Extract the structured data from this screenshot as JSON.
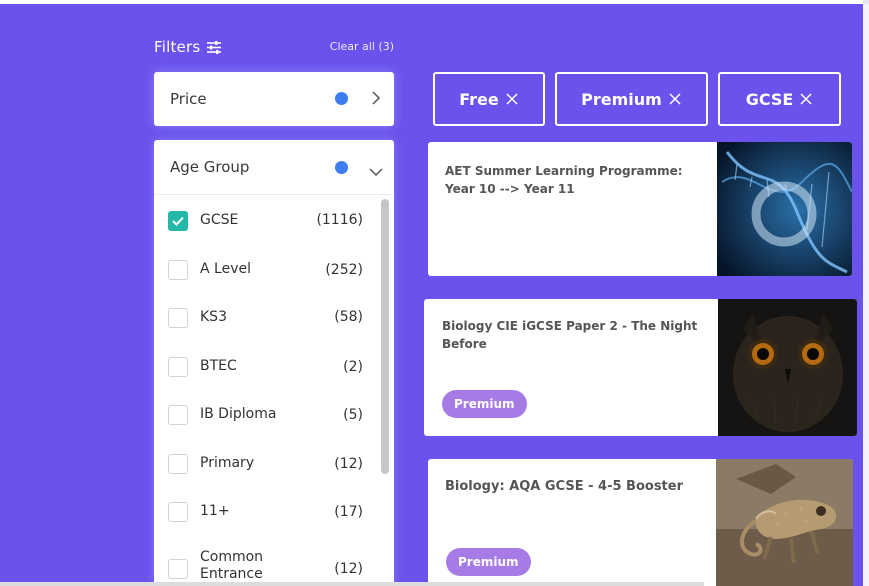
{
  "filters": {
    "title": "Filters",
    "clear_all": "Clear all (3)"
  },
  "price_panel": {
    "label": "Price"
  },
  "age_panel": {
    "label": "Age Group",
    "options": [
      {
        "label": "GCSE",
        "count": "(1116)",
        "checked": true
      },
      {
        "label": "A Level",
        "count": "(252)",
        "checked": false
      },
      {
        "label": "KS3",
        "count": "(58)",
        "checked": false
      },
      {
        "label": "BTEC",
        "count": "(2)",
        "checked": false
      },
      {
        "label": "IB Diploma",
        "count": "(5)",
        "checked": false
      },
      {
        "label": "Primary",
        "count": "(12)",
        "checked": false
      },
      {
        "label": "11+",
        "count": "(17)",
        "checked": false
      },
      {
        "label": "Common Entrance",
        "count": "(12)",
        "checked": false
      }
    ]
  },
  "active_filters": [
    {
      "label": "Free"
    },
    {
      "label": "Premium"
    },
    {
      "label": "GCSE"
    }
  ],
  "cards": [
    {
      "title": "AET Summer Learning Programme: Year 10 --> Year 11",
      "badge": "",
      "thumbnail": "dna-icon"
    },
    {
      "title": "Biology CIE iGCSE Paper 2 - The Night Before",
      "badge": "Premium",
      "thumbnail": "owl-icon"
    },
    {
      "title": "Biology: AQA GCSE - 4-5 Booster",
      "badge": "Premium",
      "thumbnail": "chameleon-icon"
    }
  ],
  "colors": {
    "background": "#6b52ec",
    "check": "#23b8a8",
    "dot": "#3d7df0",
    "badge": "#a77be6"
  }
}
